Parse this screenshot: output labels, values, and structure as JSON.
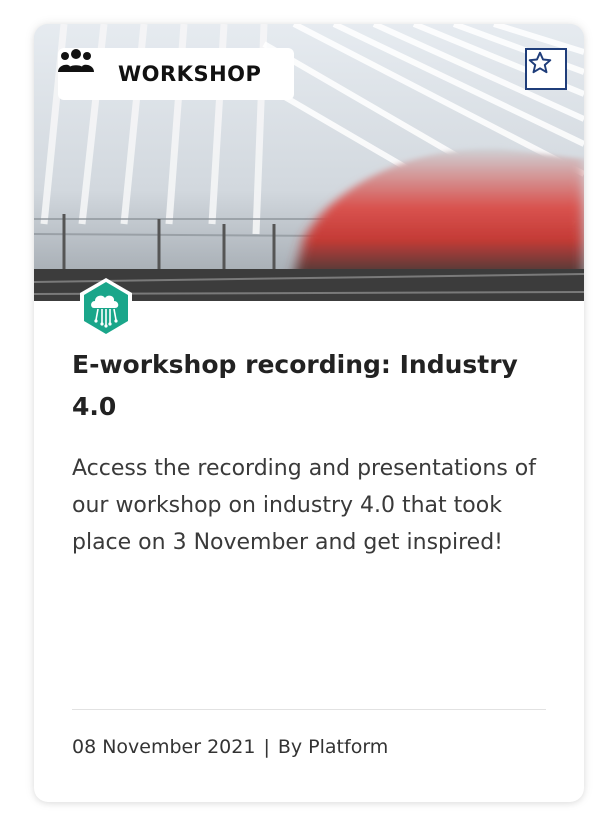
{
  "card": {
    "type_label": "WORKSHOP",
    "type_icon": "group-icon",
    "favorite_icon": "star-outline-icon",
    "topic_icon": "cloud-circuit-icon",
    "title": "E-workshop recording: Industry 4.0",
    "description": "Access the recording and presentations of our workshop on industry 4.0 that took place on 3 November and get inspired!",
    "date": "08 November 2021",
    "separator": "|",
    "author": "By Platform"
  },
  "colors": {
    "accent_blue": "#1f3d7a",
    "topic_green": "#1aa68a",
    "text_dark": "#222222"
  }
}
